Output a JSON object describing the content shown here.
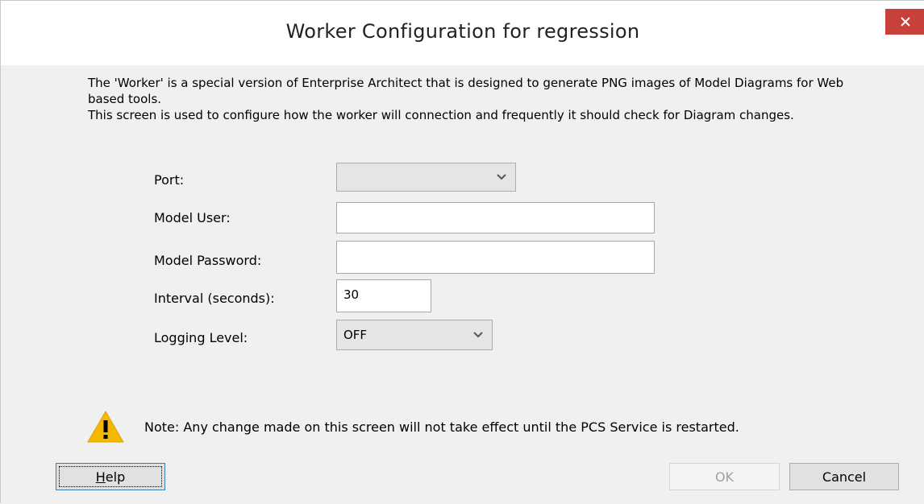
{
  "window": {
    "title": "Worker Configuration for regression",
    "close_icon": "close-icon"
  },
  "intro": {
    "line1": "The 'Worker' is a special version of Enterprise Architect that is designed to generate PNG images of Model Diagrams for Web based tools.",
    "line2": "This screen is used to configure how the worker will connection and frequently it should check for Diagram changes."
  },
  "fields": {
    "port": {
      "label": "Port:",
      "value": ""
    },
    "model_user": {
      "label": "Model User:",
      "value": ""
    },
    "model_password": {
      "label": "Model Password:",
      "value": ""
    },
    "interval": {
      "label": "Interval (seconds):",
      "value": "30"
    },
    "logging_level": {
      "label": "Logging Level:",
      "value": "OFF"
    }
  },
  "note": {
    "icon": "warning-icon",
    "text": "Note: Any change made on this screen will not take effect until the PCS Service is restarted."
  },
  "buttons": {
    "help": "Help",
    "ok": "OK",
    "cancel": "Cancel"
  },
  "colors": {
    "close_bg": "#c7413a",
    "warning": "#f5b800",
    "dialog_bg": "#f0f0f0"
  }
}
